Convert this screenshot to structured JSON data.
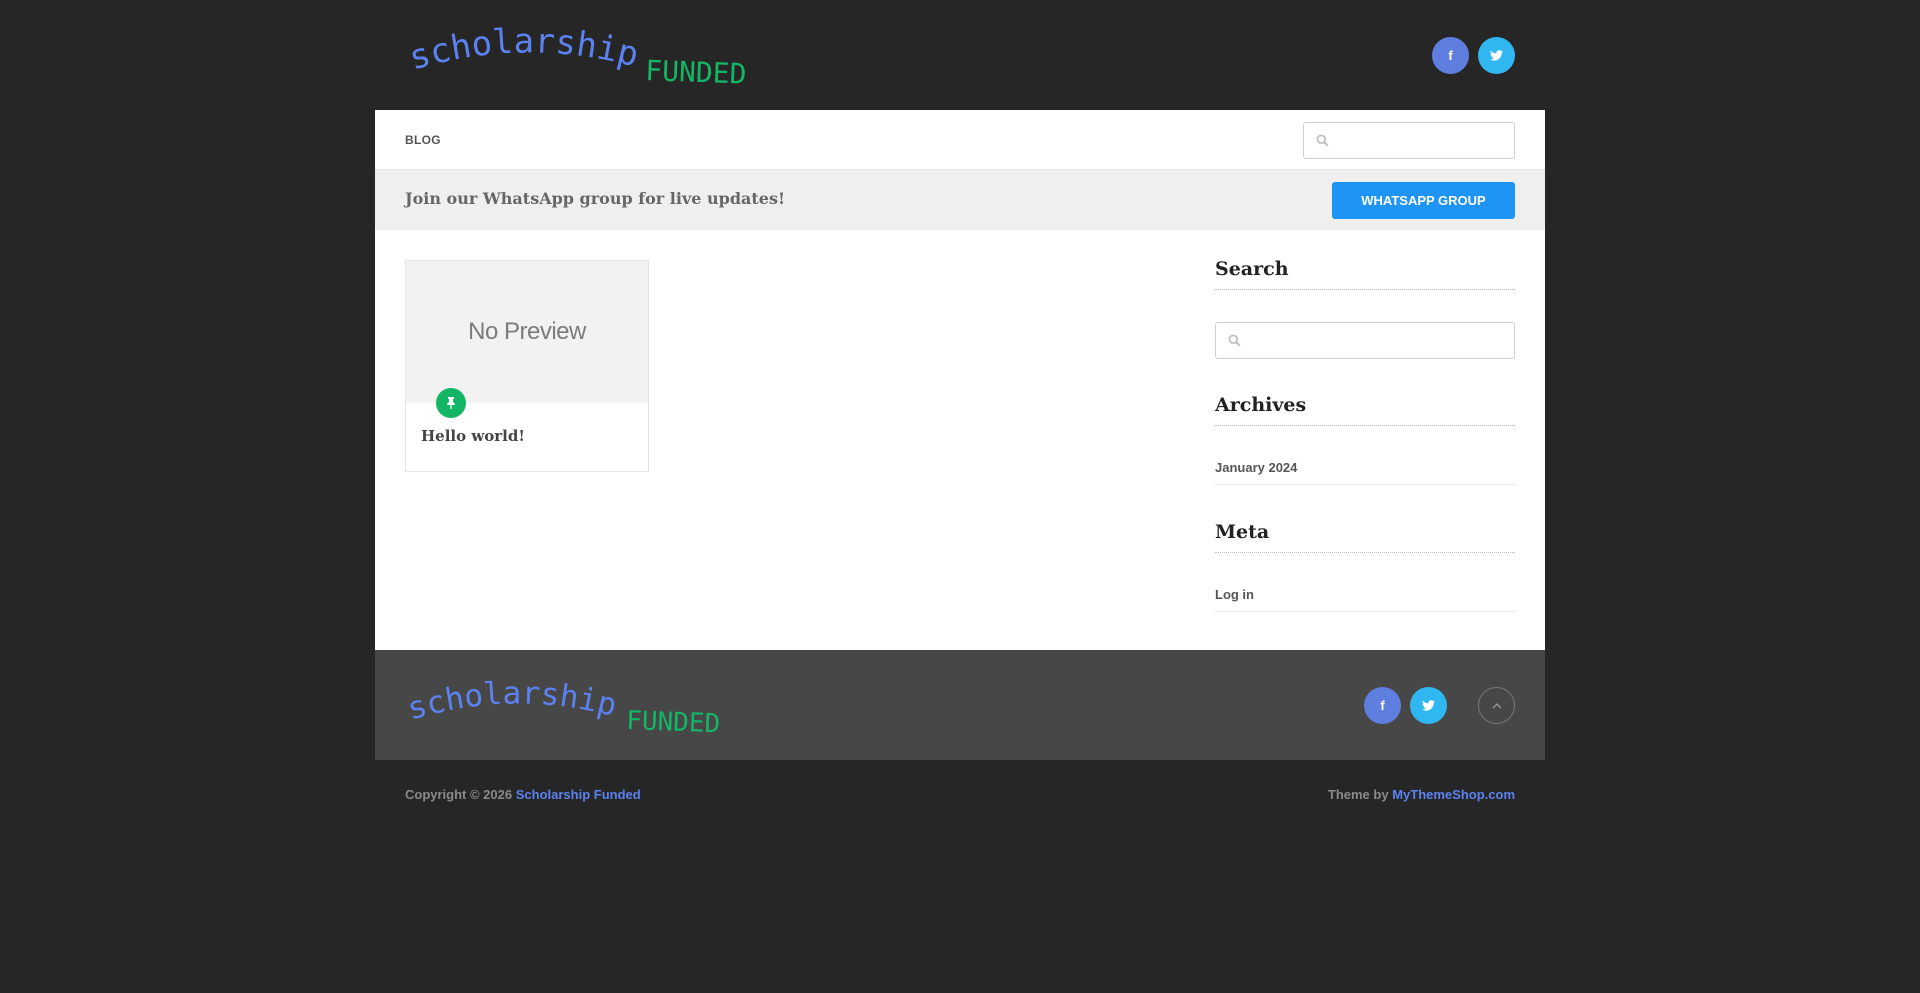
{
  "brand": {
    "logo_part1": "scholarship~",
    "logo_part2": "FUNDED",
    "logo_color1": "#5b82f0",
    "logo_color2": "#12b664"
  },
  "social": {
    "facebook_label": "f",
    "twitter_icon": "twitter-icon",
    "facebook_color": "#5f7fe0",
    "twitter_color": "#30b7f2"
  },
  "nav": {
    "items": [
      {
        "label": "BLOG"
      }
    ],
    "search_placeholder": ""
  },
  "notice": {
    "text": "Join our WhatsApp group for live updates!",
    "button_label": "WHATSAPP GROUP",
    "button_color": "#1e95f4"
  },
  "posts": [
    {
      "thumbnail_text": "No Preview",
      "title": "Hello world!",
      "badge_icon": "pin-icon"
    }
  ],
  "sidebar": {
    "search": {
      "title": "Search",
      "placeholder": ""
    },
    "archives": {
      "title": "Archives",
      "items": [
        "January 2024"
      ]
    },
    "meta": {
      "title": "Meta",
      "items": [
        "Log in"
      ]
    }
  },
  "footer": {
    "copyright_prefix": "Copyright © 2026",
    "site_link": "Scholarship Funded",
    "theme_prefix": "Theme by",
    "theme_link": "MyThemeShop.com"
  }
}
